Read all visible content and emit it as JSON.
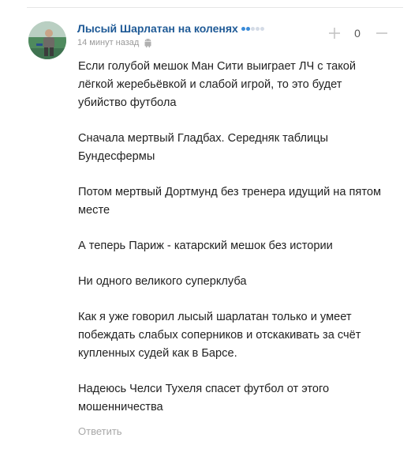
{
  "comment": {
    "author": "Лысый Шарлатан на коленях",
    "time": "14 минут назад",
    "rating_level": 2,
    "rating_max": 5,
    "votes": "0",
    "paragraphs": [
      "Если голубой мешок Ман Сити выиграет ЛЧ с такой лёгкой жеребьёвкой и слабой игрой, то это будет убийство футбола",
      "Сначала мертвый Гладбах. Середняк таблицы Бундесфермы",
      "Потом мертвый Дортмунд без тренера идущий на пятом месте",
      "А теперь Париж - катарский мешок без истории",
      "Ни одного великого суперклуба",
      "Как я уже говорил лысый шарлатан только и умеет побеждать слабых соперников и отскакивать за счёт купленных судей как в Барсе.",
      "Надеюсь Челси Тухеля спасет футбол от этого мошенничества"
    ],
    "reply_label": "Ответить"
  },
  "icons": {
    "platform": "android-icon",
    "upvote": "plus-icon",
    "downvote": "minus-icon"
  },
  "colors": {
    "author_link": "#1f5a96",
    "rating_active": "#3a8bd8",
    "rating_inactive": "#d4dbe6",
    "muted_text": "#9a9a9a"
  }
}
